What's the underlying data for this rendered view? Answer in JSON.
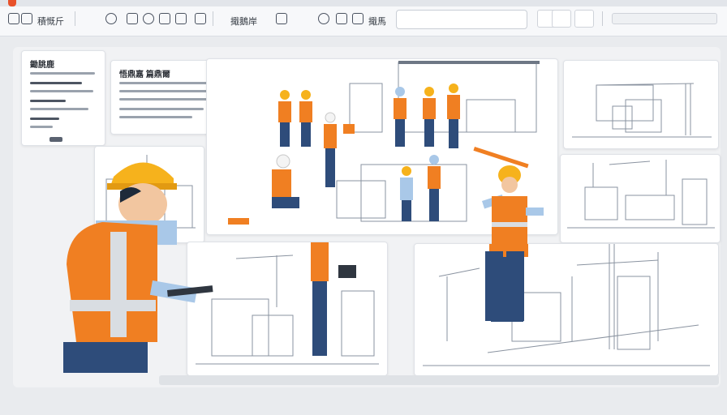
{
  "toolbar": {
    "title": "積慨斤",
    "item_two": "擑鵝岸",
    "item_three": "擑馬"
  },
  "side_panel": {
    "title": "鋤朓鹿"
  },
  "header_card": {
    "title": "悟鼎嘉 篇鼎爾"
  },
  "colors": {
    "vest": "#f07f22",
    "helmet": "#f6b21c",
    "shirt": "#a9c8e8",
    "pants": "#2e4c7a",
    "accent": "#e8512a"
  }
}
